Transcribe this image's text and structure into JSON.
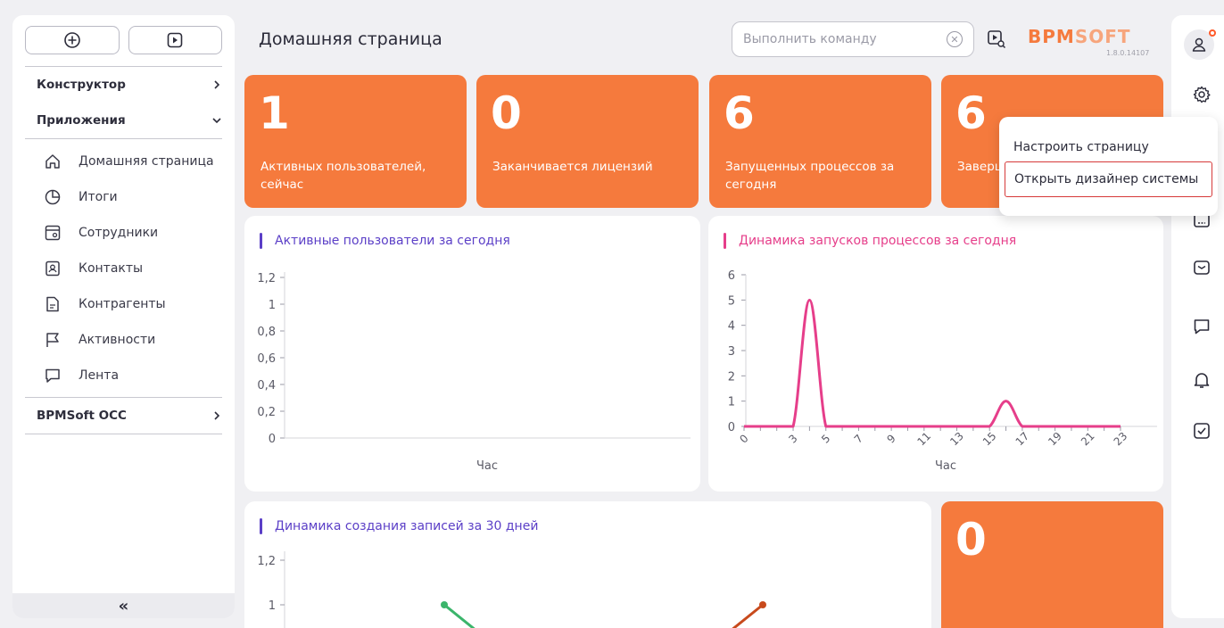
{
  "sidebar": {
    "sections": [
      {
        "label": "Конструктор"
      },
      {
        "label": "Приложения"
      },
      {
        "label": "BPMSoft OCC"
      }
    ],
    "items": [
      {
        "label": "Домашняя страница",
        "icon": "home-icon"
      },
      {
        "label": "Итоги",
        "icon": "pie-chart-icon"
      },
      {
        "label": "Сотрудники",
        "icon": "employee-icon"
      },
      {
        "label": "Контакты",
        "icon": "contact-icon"
      },
      {
        "label": "Контрагенты",
        "icon": "document-icon"
      },
      {
        "label": "Активности",
        "icon": "flag-icon"
      },
      {
        "label": "Лента",
        "icon": "chat-icon"
      }
    ],
    "collapse_label": "«"
  },
  "header": {
    "title": "Домашняя страница",
    "command_placeholder": "Выполнить команду",
    "logo_main": "BPM",
    "logo_accent": "SOFT",
    "version": "1.8.0.14107"
  },
  "kpis": [
    {
      "value": "1",
      "label": "Активных пользователей, сейчас"
    },
    {
      "value": "0",
      "label": "Заканчивается лицензий"
    },
    {
      "value": "6",
      "label": "Запущенных процессов за сегодня"
    },
    {
      "value": "6",
      "label": "Заверш... сегодн..."
    }
  ],
  "kpi_bottom": {
    "value": "0"
  },
  "menu": {
    "items": [
      {
        "label": "Настроить страницу"
      },
      {
        "label": "Открыть дизайнер системы"
      }
    ]
  },
  "colors": {
    "accent": "#f57a3d",
    "purple": "#5b3fc7",
    "pink": "#e63e8a",
    "green": "#3bb56b",
    "rust": "#c84a1c"
  },
  "chart_data": [
    {
      "type": "line",
      "title": "Активные пользователи за сегодня",
      "xlabel": "Час",
      "ylabel": "",
      "yticks": [
        "0",
        "0,2",
        "0,4",
        "0,6",
        "0,8",
        "1",
        "1,2"
      ],
      "ylim": [
        0,
        1.2
      ],
      "series": []
    },
    {
      "type": "line",
      "title": "Динамика запусков процессов за сегодня",
      "xlabel": "Час",
      "ylabel": "",
      "ylim": [
        0,
        6
      ],
      "yticks": [
        "0",
        "1",
        "2",
        "3",
        "4",
        "5",
        "6"
      ],
      "xticks": [
        "0",
        "3",
        "5",
        "7",
        "9",
        "11",
        "13",
        "15",
        "17",
        "19",
        "21",
        "23"
      ],
      "x": [
        0,
        1,
        2,
        3,
        4,
        5,
        6,
        7,
        8,
        9,
        10,
        11,
        12,
        13,
        14,
        15,
        16,
        17,
        18,
        19,
        20,
        21,
        22,
        23
      ],
      "series": [
        {
          "values": [
            0,
            0,
            0,
            0,
            5,
            0,
            0,
            0,
            0,
            0,
            0,
            0,
            0,
            0,
            0,
            0,
            1,
            0,
            0,
            0,
            0,
            0,
            0,
            0
          ]
        }
      ]
    },
    {
      "type": "line",
      "title": "Динамика создания записей за 30 дней",
      "xlabel": "",
      "ylabel": "",
      "yticks": [
        "1",
        "1,2"
      ],
      "series": [
        {
          "values": [
            1,
            0.8
          ]
        },
        {
          "values": [
            0.8,
            1
          ]
        }
      ]
    }
  ]
}
